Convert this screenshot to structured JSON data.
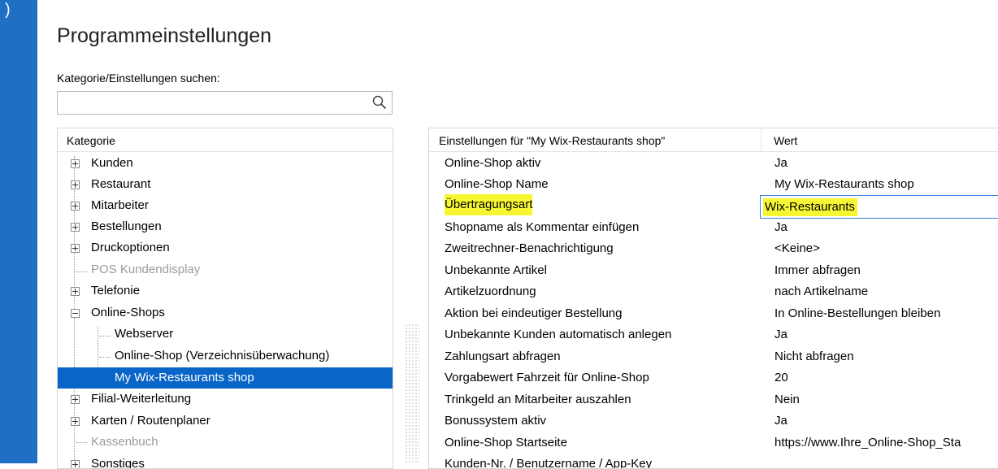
{
  "page": {
    "title": "Programmeinstellungen",
    "search_label": "Kategorie/Einstellungen suchen:",
    "search_value": "",
    "search_placeholder": ""
  },
  "category_panel": {
    "header": "Kategorie",
    "items": [
      {
        "label": "Kunden",
        "state": "collapsed"
      },
      {
        "label": "Restaurant",
        "state": "collapsed"
      },
      {
        "label": "Mitarbeiter",
        "state": "collapsed"
      },
      {
        "label": "Bestellungen",
        "state": "collapsed"
      },
      {
        "label": "Druckoptionen",
        "state": "collapsed"
      },
      {
        "label": "POS Kundendisplay",
        "state": "leaf-disabled"
      },
      {
        "label": "Telefonie",
        "state": "collapsed"
      },
      {
        "label": "Online-Shops",
        "state": "expanded"
      },
      {
        "label": "Webserver",
        "state": "child"
      },
      {
        "label": "Online-Shop (Verzeichnisüberwachung)",
        "state": "child"
      },
      {
        "label": "My Wix-Restaurants shop",
        "state": "child-selected"
      },
      {
        "label": "Filial-Weiterleitung",
        "state": "collapsed"
      },
      {
        "label": "Karten / Routenplaner",
        "state": "collapsed"
      },
      {
        "label": "Kassenbuch",
        "state": "leaf-disabled"
      },
      {
        "label": "Sonstiges",
        "state": "collapsed"
      }
    ]
  },
  "settings_panel": {
    "header_name": "Einstellungen für \"My Wix-Restaurants shop\"",
    "header_value": "Wert",
    "rows": [
      {
        "name": "Online-Shop aktiv",
        "value": "Ja"
      },
      {
        "name": "Online-Shop Name",
        "value": "My Wix-Restaurants shop"
      },
      {
        "name": "Übertragungsart",
        "value": "Wix-Restaurants"
      },
      {
        "name": "Shopname als Kommentar einfügen",
        "value": "Ja"
      },
      {
        "name": "Zweitrechner-Benachrichtigung",
        "value": "<Keine>"
      },
      {
        "name": "Unbekannte Artikel",
        "value": "Immer abfragen"
      },
      {
        "name": "Artikelzuordnung",
        "value": "nach Artikelname"
      },
      {
        "name": "Aktion bei eindeutiger Bestellung",
        "value": "In Online-Bestellungen bleiben"
      },
      {
        "name": "Unbekannte Kunden automatisch anlegen",
        "value": "Ja"
      },
      {
        "name": "Zahlungsart abfragen",
        "value": "Nicht abfragen"
      },
      {
        "name": "Vorgabewert Fahrzeit für Online-Shop",
        "value": "20"
      },
      {
        "name": "Trinkgeld an Mitarbeiter auszahlen",
        "value": "Nein"
      },
      {
        "name": "Bonussystem aktiv",
        "value": "Ja"
      },
      {
        "name": "Online-Shop Startseite",
        "value": "https://www.Ihre_Online-Shop_Sta"
      },
      {
        "name": "Kunden-Nr. / Benutzername / App-Key",
        "value": ""
      }
    ]
  },
  "colors": {
    "accent": "#1f6fc5",
    "selection": "#0a65c8",
    "highlight": "#f6f633",
    "edit_border": "#3b7fd8"
  },
  "icons": [
    "search-icon",
    "plus-expander-icon",
    "minus-expander-icon"
  ]
}
